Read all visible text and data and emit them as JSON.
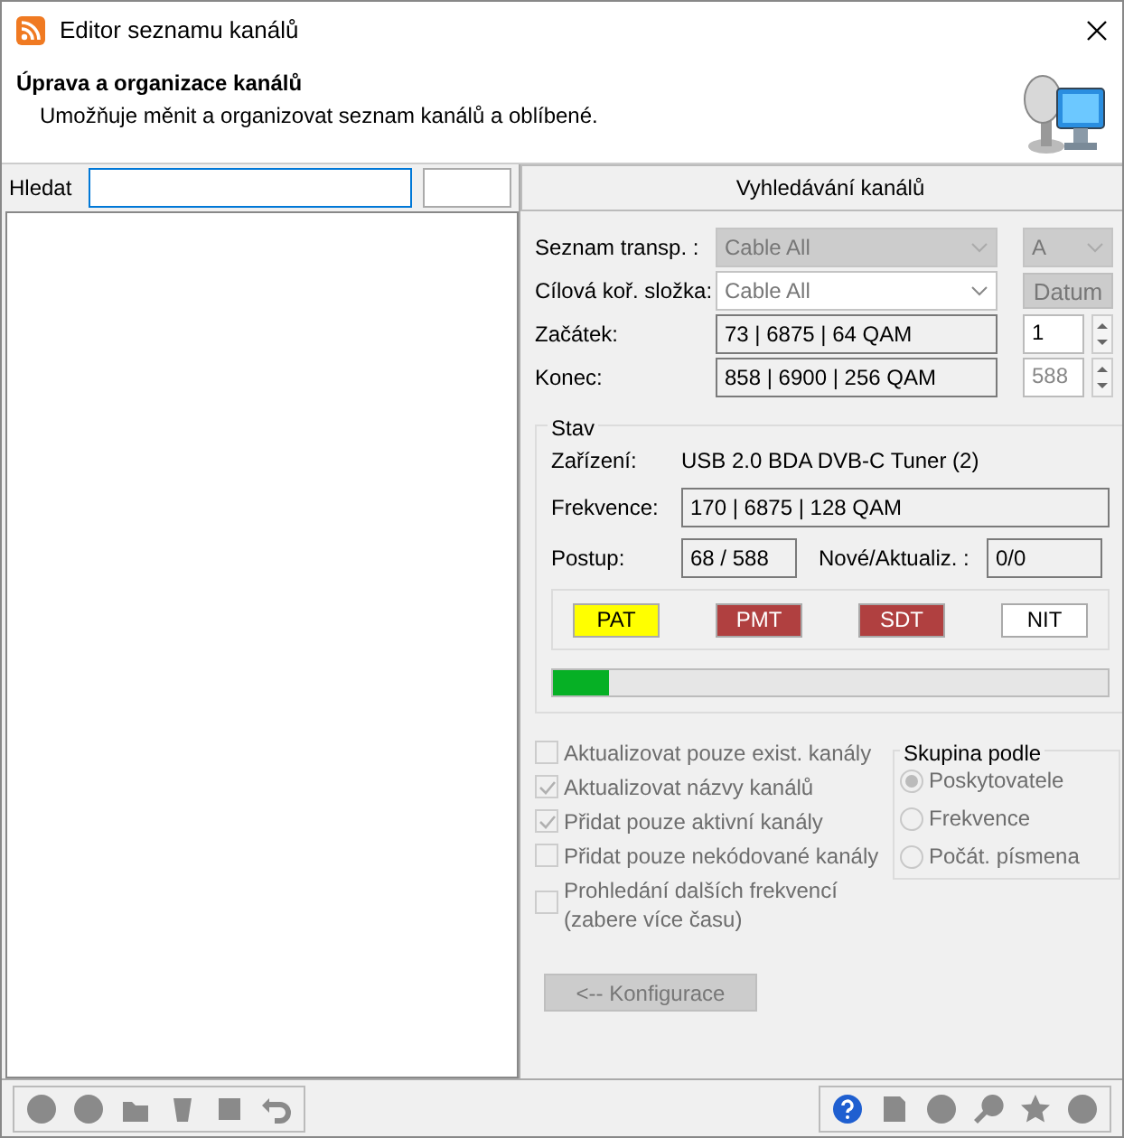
{
  "window": {
    "title": "Editor seznamu kanálů"
  },
  "header": {
    "title": "Úprava a organizace kanálů",
    "subtitle": "Umožňuje měnit a organizovat seznam kanálů a oblíbené."
  },
  "search": {
    "label": "Hledat"
  },
  "scan_tab": {
    "label": "Vyhledávání kanálů"
  },
  "fields": [
    {
      "kind": "select",
      "label": "Seznam transp. :",
      "value": "Cable All",
      "disabled": true,
      "side": {
        "kind": "select",
        "value": "A"
      }
    },
    {
      "kind": "select",
      "label": "Cílová koř. složka:",
      "value": "Cable All",
      "disabled": false,
      "side": {
        "kind": "button",
        "value": "Datum"
      }
    },
    {
      "kind": "readout",
      "label": "Začátek:",
      "value": "73 | 6875 | 64 QAM",
      "side": {
        "kind": "spin",
        "value": "1",
        "disabled": false
      }
    },
    {
      "kind": "readout",
      "label": "Konec:",
      "value": "858 | 6900 | 256 QAM",
      "side": {
        "kind": "spin",
        "value": "588",
        "disabled": true
      }
    }
  ],
  "status": {
    "title": "Stav",
    "device_label": "Zařízení:",
    "device": "USB 2.0 BDA DVB-C Tuner (2)",
    "freq_label": "Frekvence:",
    "freq": "170 | 6875 | 128 QAM",
    "progress_label": "Postup:",
    "progress": "68 / 588",
    "new_label": "Nové/Aktualiz. :",
    "new": "0/0",
    "tables": [
      {
        "label": "PAT",
        "color": "#ffff00"
      },
      {
        "label": "PMT",
        "color": "#b04040"
      },
      {
        "label": "SDT",
        "color": "#b04040"
      },
      {
        "label": "NIT",
        "color": "#ffffff"
      }
    ],
    "level": 0.1
  },
  "options": [
    {
      "label": "Aktualizovat pouze exist. kanály",
      "checked": false
    },
    {
      "label": "Aktualizovat názvy kanálů",
      "checked": true
    },
    {
      "label": "Přidat pouze aktivní kanály",
      "checked": true
    },
    {
      "label": "Přidat pouze nekódované kanály",
      "checked": false
    },
    {
      "label": "Prohledání dalších frekvencí (zabere více času)",
      "checked": false
    }
  ],
  "group_by": {
    "title": "Skupina podle",
    "options": [
      {
        "label": "Poskytovatele",
        "selected": true
      },
      {
        "label": "Frekvence",
        "selected": false
      },
      {
        "label": "Počát. písmena",
        "selected": false
      }
    ]
  },
  "config_button": {
    "label": "<-- Konfigurace"
  }
}
